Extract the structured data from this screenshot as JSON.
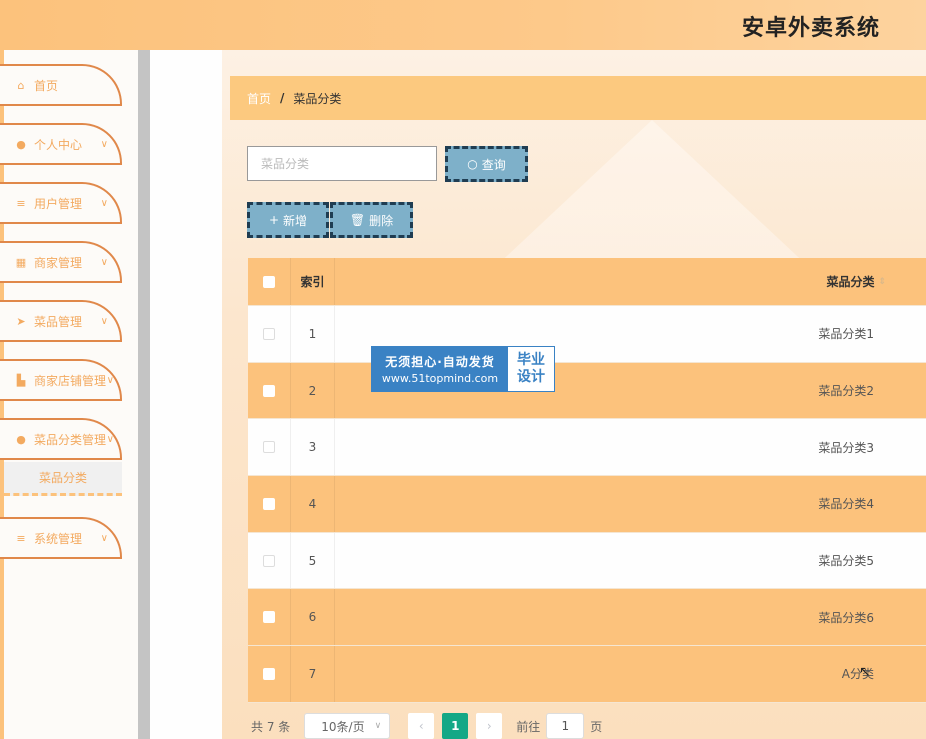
{
  "header": {
    "title": "安卓外卖系统"
  },
  "sidebar": {
    "items": [
      {
        "label": "首页",
        "icon": "home-icon",
        "glyph": "⌂",
        "has_chevron": false
      },
      {
        "label": "个人中心",
        "icon": "user-icon",
        "glyph": "●",
        "has_chevron": true
      },
      {
        "label": "用户管理",
        "icon": "list-icon",
        "glyph": "≡",
        "has_chevron": true
      },
      {
        "label": "商家管理",
        "icon": "grid-icon",
        "glyph": "▦",
        "has_chevron": true
      },
      {
        "label": "菜品管理",
        "icon": "send-icon",
        "glyph": "➤",
        "has_chevron": true
      },
      {
        "label": "商家店铺管理",
        "icon": "shop-icon",
        "glyph": "▙",
        "has_chevron": true
      },
      {
        "label": "菜品分类管理",
        "icon": "location-icon",
        "glyph": "●",
        "has_chevron": true
      },
      {
        "label": "系统管理",
        "icon": "list-icon",
        "glyph": "≡",
        "has_chevron": true
      }
    ],
    "chevron": "∨",
    "active_submenu": "菜品分类"
  },
  "breadcrumb": {
    "home": "首页",
    "separator": "/",
    "current": "菜品分类"
  },
  "search": {
    "placeholder": "菜品分类",
    "button_label": "查询",
    "button_icon": "○"
  },
  "actions": {
    "add_label": "新增",
    "add_icon": "+",
    "delete_label": "删除",
    "delete_icon": "🗑"
  },
  "table": {
    "columns": {
      "index": "索引",
      "name": "菜品分类",
      "sort_glyph": "⇕"
    },
    "rows": [
      {
        "index": "1",
        "name": "菜品分类1"
      },
      {
        "index": "2",
        "name": "菜品分类2"
      },
      {
        "index": "3",
        "name": "菜品分类3"
      },
      {
        "index": "4",
        "name": "菜品分类4"
      },
      {
        "index": "5",
        "name": "菜品分类5"
      },
      {
        "index": "6",
        "name": "菜品分类6"
      },
      {
        "index": "7",
        "name": "A分类"
      }
    ]
  },
  "pagination": {
    "total": "共 7 条",
    "page_size": "10条/页",
    "prev_glyph": "‹",
    "current_page": "1",
    "next_glyph": "›",
    "goto_label": "前往",
    "goto_value": "1",
    "goto_unit": "页"
  },
  "watermark": {
    "line1": "无须担心·自动发货",
    "line2": "www.51topmind.com",
    "badge_line1": "毕业",
    "badge_line2": "设计"
  },
  "colors": {
    "header": "#fcc27c",
    "sidebar_border": "#e0884a",
    "sidebar_text": "#f3aa60",
    "row_highlight": "#fcc27c",
    "button": "#7eb0c9",
    "button_border": "#1f3d52",
    "page_active": "#14a886",
    "watermark_blue": "#3a82c4"
  }
}
